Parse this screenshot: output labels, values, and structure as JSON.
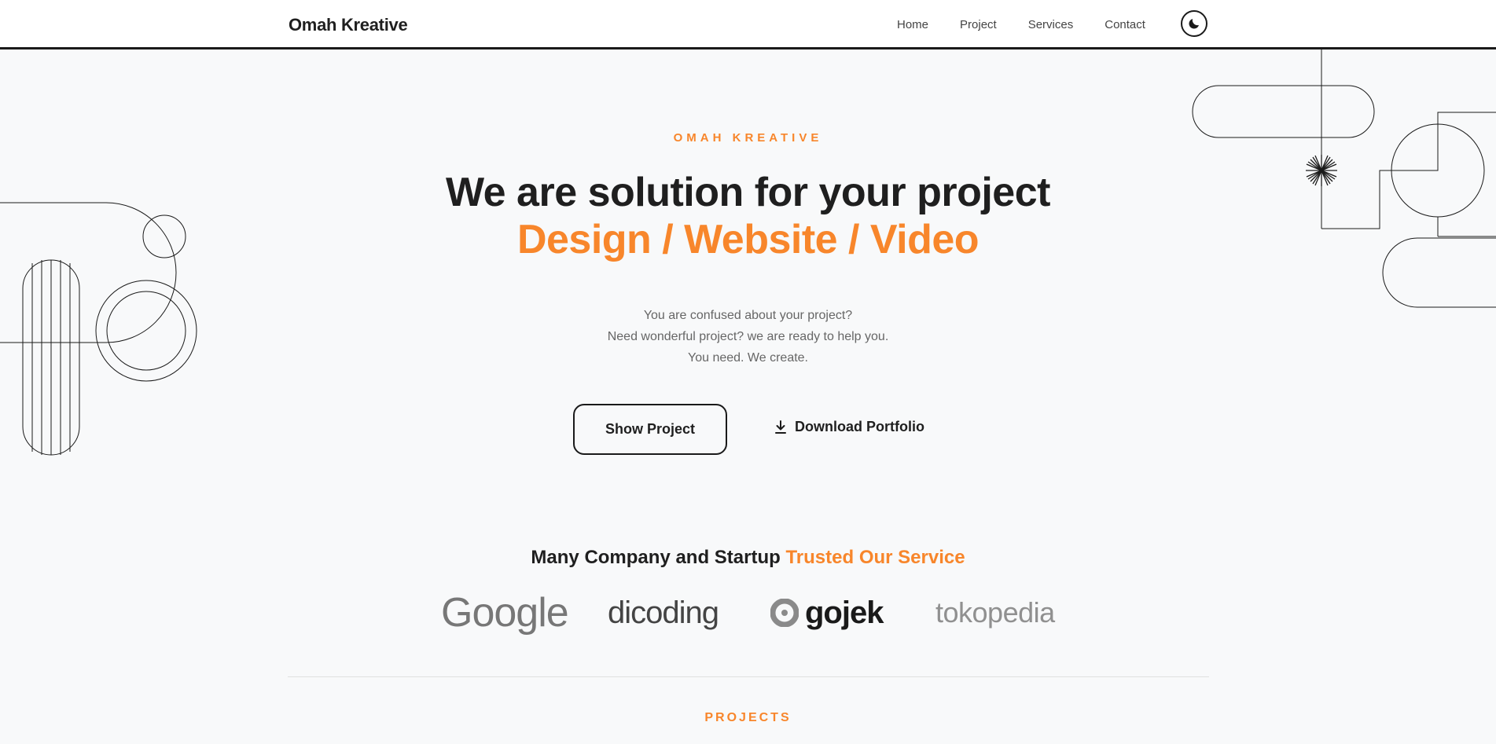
{
  "navbar": {
    "brand": "Omah Kreative",
    "links": [
      "Home",
      "Project",
      "Services",
      "Contact"
    ],
    "theme_toggle_icon": "moon-icon"
  },
  "hero": {
    "eyebrow": "OMAH KREATIVE",
    "title": "We are solution for your project",
    "subtitle": "Design / Website / Video",
    "description": [
      "You are confused about your project?",
      "Need wonderful project? we are ready to help you.",
      "You need. We create."
    ],
    "primary_button": "Show Project",
    "secondary_button": "Download Portfolio",
    "secondary_button_icon": "download-icon"
  },
  "trusted": {
    "text": "Many Company and Startup",
    "highlight": "Trusted Our Service",
    "logos": [
      "Google",
      "dicoding",
      "gojek",
      "tokopedia"
    ]
  },
  "projects": {
    "label": "PROJECTS"
  },
  "colors": {
    "accent": "#f8862b",
    "text": "#1f1f1f",
    "background": "#f8f9fa",
    "muted": "#666666"
  }
}
